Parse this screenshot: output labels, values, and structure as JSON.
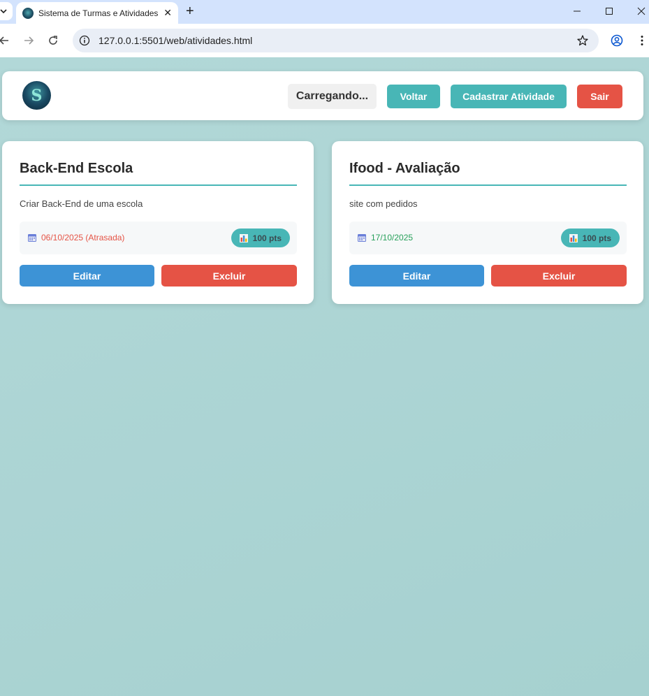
{
  "browser": {
    "tab_title": "Sistema de Turmas e Atividades",
    "url": "127.0.0.1:5501/web/atividades.html"
  },
  "header": {
    "user_label": "Carregando...",
    "voltar_label": "Voltar",
    "cadastrar_label": "Cadastrar Atividade",
    "sair_label": "Sair"
  },
  "colors": {
    "accent": "#48b6b6",
    "danger": "#e55345",
    "edit": "#3d93d6",
    "late_date": "#e55345",
    "ok_date": "#27a05a"
  },
  "activities": [
    {
      "title": "Back-End Escola",
      "description": "Criar Back-End de uma escola",
      "date": "06/10/2025 (Atrasada)",
      "points": "100 pts",
      "edit_label": "Editar",
      "delete_label": "Excluir"
    },
    {
      "title": "Ifood - Avaliação",
      "description": "site com pedidos",
      "date": "17/10/2025",
      "points": "100 pts",
      "edit_label": "Editar",
      "delete_label": "Excluir"
    }
  ]
}
